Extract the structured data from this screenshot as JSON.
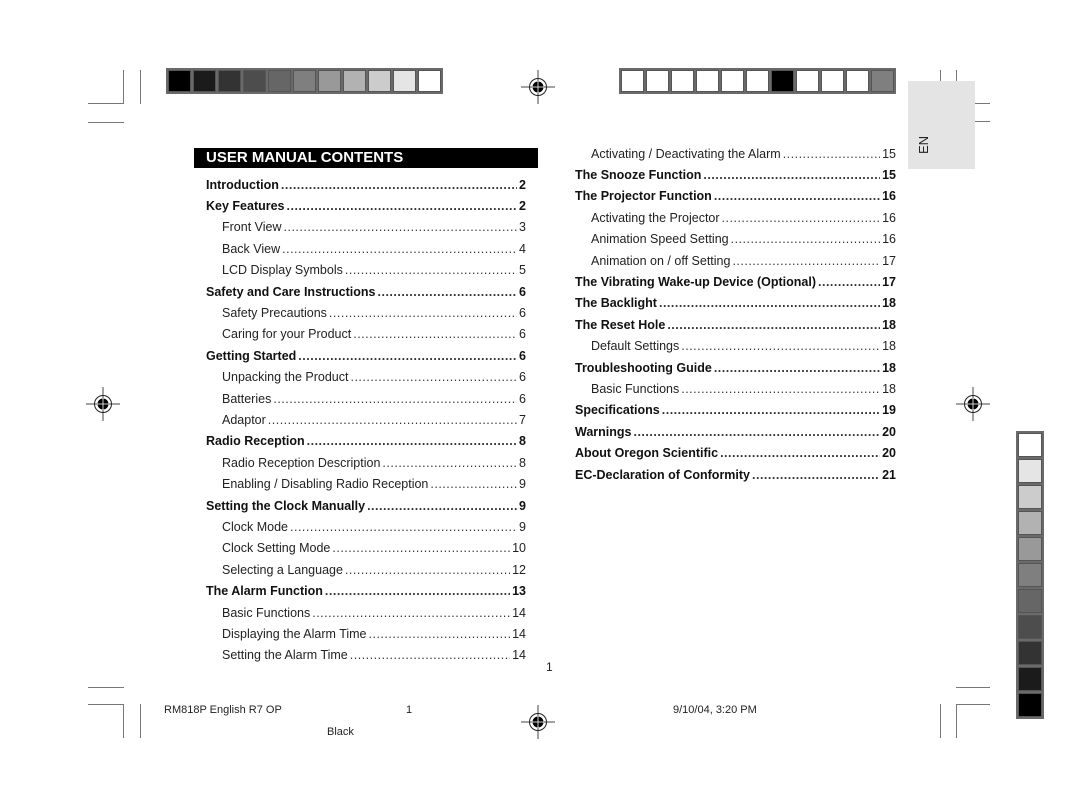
{
  "heading": "USER MANUAL CONTENTS",
  "language_tab": "EN",
  "page_number": "1",
  "toc_left": [
    {
      "label": "Introduction",
      "page": "2",
      "level": 1
    },
    {
      "label": "Key Features",
      "page": "2",
      "level": 1
    },
    {
      "label": "Front View",
      "page": "3",
      "level": 2
    },
    {
      "label": "Back View",
      "page": "4",
      "level": 2
    },
    {
      "label": "LCD Display Symbols",
      "page": "5",
      "level": 2
    },
    {
      "label": "Safety and Care Instructions",
      "page": "6",
      "level": 1
    },
    {
      "label": "Safety Precautions",
      "page": "6",
      "level": 2
    },
    {
      "label": "Caring for your Product",
      "page": "6",
      "level": 2
    },
    {
      "label": "Getting Started",
      "page": "6",
      "level": 1
    },
    {
      "label": "Unpacking the Product",
      "page": "6",
      "level": 2
    },
    {
      "label": "Batteries",
      "page": "6",
      "level": 2
    },
    {
      "label": "Adaptor",
      "page": "7",
      "level": 2
    },
    {
      "label": "Radio Reception",
      "page": "8",
      "level": 1
    },
    {
      "label": "Radio Reception Description",
      "page": "8",
      "level": 2
    },
    {
      "label": "Enabling / Disabling Radio Reception",
      "page": "9",
      "level": 2
    },
    {
      "label": "Setting the Clock Manually",
      "page": "9",
      "level": 1
    },
    {
      "label": "Clock Mode",
      "page": "9",
      "level": 2
    },
    {
      "label": "Clock Setting Mode",
      "page": "10",
      "level": 2
    },
    {
      "label": "Selecting a Language",
      "page": "12",
      "level": 2
    },
    {
      "label": "The Alarm Function",
      "page": "13",
      "level": 1
    },
    {
      "label": "Basic Functions",
      "page": "14",
      "level": 2
    },
    {
      "label": "Displaying the Alarm Time",
      "page": "14",
      "level": 2
    },
    {
      "label": "Setting the Alarm Time",
      "page": "14",
      "level": 2
    }
  ],
  "toc_right": [
    {
      "label": "Activating / Deactivating the Alarm",
      "page": "15",
      "level": 2
    },
    {
      "label": "The Snooze Function",
      "page": "15",
      "level": 1
    },
    {
      "label": "The Projector Function",
      "page": "16",
      "level": 1
    },
    {
      "label": "Activating the Projector",
      "page": "16",
      "level": 2
    },
    {
      "label": "Animation Speed Setting",
      "page": "16",
      "level": 2
    },
    {
      "label": "Animation on / off Setting",
      "page": "17",
      "level": 2
    },
    {
      "label": "The Vibrating Wake-up Device (Optional)",
      "page": "17",
      "level": 1
    },
    {
      "label": "The Backlight",
      "page": "18",
      "level": 1
    },
    {
      "label": "The Reset Hole",
      "page": "18",
      "level": 1
    },
    {
      "label": "Default Settings",
      "page": "18",
      "level": 2
    },
    {
      "label": "Troubleshooting Guide",
      "page": "18",
      "level": 1
    },
    {
      "label": "Basic Functions",
      "page": "18",
      "level": 2
    },
    {
      "label": "Specifications",
      "page": "19",
      "level": 1
    },
    {
      "label": "Warnings",
      "page": "20",
      "level": 1
    },
    {
      "label": "About Oregon Scientific",
      "page": "20",
      "level": 1
    },
    {
      "label": "EC-Declaration of Conformity",
      "page": "21",
      "level": 1
    }
  ],
  "footer": {
    "file": "RM818P English R7 OP",
    "sheet": "1",
    "timestamp": "9/10/04, 3:20 PM",
    "plate": "Black"
  },
  "gray_strip_top_left": [
    "#000000",
    "#1b1b1b",
    "#333333",
    "#4d4d4d",
    "#666666",
    "#7f7f7f",
    "#999999",
    "#b2b2b2",
    "#cccccc",
    "#e5e5e5",
    "#ffffff"
  ],
  "gray_strip_top_right": [
    "#ffffff",
    "#ffffff",
    "#ffffff",
    "#ffffff",
    "#ffffff",
    "#ffffff",
    "#000000",
    "#ffffff",
    "#ffffff",
    "#ffffff",
    "#7f7f7f"
  ],
  "gray_strip_right": [
    "#ffffff",
    "#e5e5e5",
    "#cccccc",
    "#b2b2b2",
    "#999999",
    "#7f7f7f",
    "#666666",
    "#4d4d4d",
    "#333333",
    "#1b1b1b",
    "#000000"
  ]
}
